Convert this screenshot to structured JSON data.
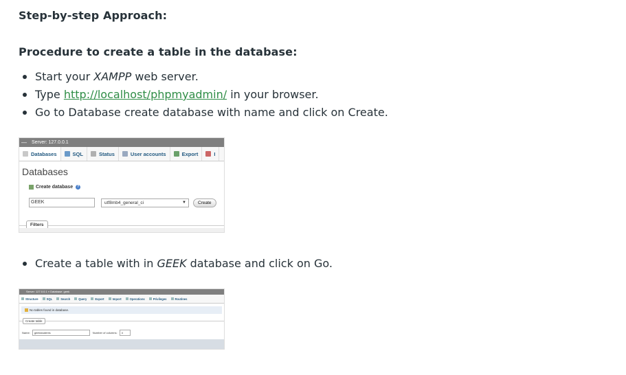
{
  "headings": {
    "approach": "Step-by-step Approach:",
    "procedure": "Procedure to create a table in the database:"
  },
  "steps": [
    {
      "before": "Start your ",
      "em": "XAMPP",
      "after": " web server."
    },
    {
      "before": "Type ",
      "link": "http://localhost/phpmyadmin/",
      "after": " in your browser."
    },
    {
      "before": "Go to Database create database with name and click on Create."
    },
    {
      "before": "Create a table with in ",
      "em": "GEEK",
      "after": " database and click on Go."
    }
  ],
  "shot1": {
    "topbar": "Server: 127.0.0.1",
    "tabs": [
      "Databases",
      "SQL",
      "Status",
      "User accounts",
      "Export",
      "I"
    ],
    "tab_colors": [
      "#c9c9c9",
      "#6a9ac9",
      "#b0b0b0",
      "#9aa9c0",
      "#6aa06a",
      "#c66"
    ],
    "title": "Databases",
    "create_label": "Create database",
    "db_name_value": "GEEK",
    "collation": "utf8mb4_general_ci",
    "create_button": "Create",
    "filters": "Filters"
  },
  "shot2": {
    "topbar": "Server: 127.0.0.1 » Database: geek",
    "tabs": [
      "Structure",
      "SQL",
      "Search",
      "Query",
      "Export",
      "Import",
      "Operations",
      "Privileges",
      "Routines"
    ],
    "notice": "No tables found in database.",
    "create_table": "Create table",
    "name_label": "Name:",
    "name_value": "geekstudents",
    "cols_label": "Number of columns:",
    "cols_value": "4"
  },
  "colors": {
    "link": "#2f8d46",
    "text": "#273239"
  }
}
